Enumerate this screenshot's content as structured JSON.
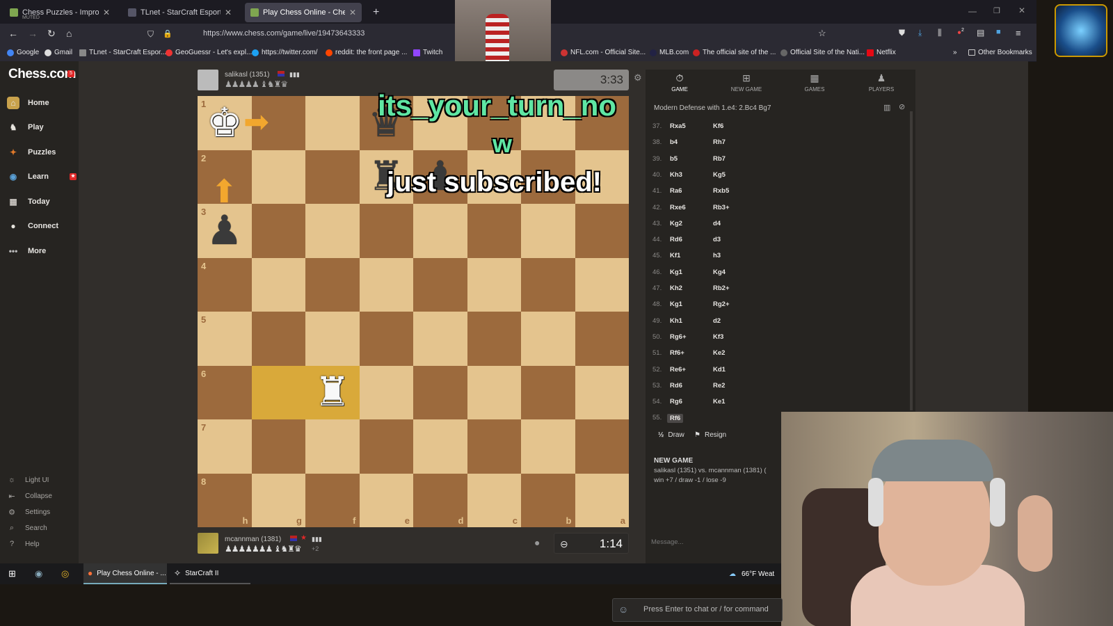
{
  "browser": {
    "tabs": [
      {
        "label": "Chess Puzzles - Improve Your C",
        "sub": "MUTED",
        "active": false
      },
      {
        "label": "TLnet - StarCraft Esports News",
        "active": false
      },
      {
        "label": "Play Chess Online - Chess.com",
        "active": true
      }
    ],
    "new_tab": "+",
    "url": "https://www.chess.com/game/live/19473643333",
    "bookmarks": [
      "Google",
      "Gmail",
      "TLnet - StarCraft Espor...",
      "GeoGuessr - Let's expl...",
      "https://twitter.com/",
      "reddit: the front page ...",
      "Twitch",
      "NFL.com - Official Site...",
      "MLB.com",
      "The official site of the ...",
      "Official Site of the Nati...",
      "Netflix"
    ],
    "other_bookmarks": "Other Bookmarks",
    "extension_badge": "2"
  },
  "sidebar": {
    "logo": "Chess.com",
    "logo_badge": "5",
    "items": [
      {
        "label": "Home",
        "icon": "home-icon"
      },
      {
        "label": "Play",
        "icon": "play-icon"
      },
      {
        "label": "Puzzles",
        "icon": "puzzle-icon"
      },
      {
        "label": "Learn",
        "icon": "learn-icon"
      },
      {
        "label": "Today",
        "icon": "calendar-icon"
      },
      {
        "label": "Connect",
        "icon": "connect-icon"
      },
      {
        "label": "More",
        "icon": "more-icon"
      }
    ],
    "bottom": [
      {
        "label": "Light UI",
        "icon": "sun-icon"
      },
      {
        "label": "Collapse",
        "icon": "collapse-icon"
      },
      {
        "label": "Settings",
        "icon": "gear-icon"
      },
      {
        "label": "Search",
        "icon": "search-icon"
      },
      {
        "label": "Help",
        "icon": "help-icon"
      }
    ]
  },
  "top_player": {
    "name": "salikasl (1351)",
    "captured": "♟♟♟♟♟ ♝♞♜♛",
    "clock": "3:33"
  },
  "bottom_player": {
    "name": "mcannman (1381)",
    "captured": "♟♟♟♟♟♟♟ ♝♞♜♛",
    "advantage": "+2",
    "clock": "1:14"
  },
  "board": {
    "ranks": [
      "1",
      "2",
      "3",
      "4",
      "5",
      "6",
      "7",
      "8"
    ],
    "files": [
      "h",
      "g",
      "f",
      "e",
      "d",
      "c",
      "b",
      "a"
    ],
    "highlight": [
      "g6",
      "f6"
    ]
  },
  "overlays": {
    "turn_line1": "its_your_turn_no",
    "turn_line2": "w",
    "subscribed": "just subscribed!"
  },
  "right_panel": {
    "tabs": [
      {
        "label": "GAME",
        "icon": "clock-icon"
      },
      {
        "label": "NEW GAME",
        "icon": "plus-icon"
      },
      {
        "label": "GAMES",
        "icon": "board-icon"
      },
      {
        "label": "PLAYERS",
        "icon": "players-icon"
      }
    ],
    "opening": "Modern Defense with 1.e4: 2.Bc4 Bg7",
    "moves": [
      {
        "n": "37.",
        "w": "Rxa5",
        "b": "Kf6"
      },
      {
        "n": "38.",
        "w": "b4",
        "b": "Rh7"
      },
      {
        "n": "39.",
        "w": "b5",
        "b": "Rb7"
      },
      {
        "n": "40.",
        "w": "Kh3",
        "b": "Kg5"
      },
      {
        "n": "41.",
        "w": "Ra6",
        "b": "Rxb5"
      },
      {
        "n": "42.",
        "w": "Rxe6",
        "b": "Rb3+"
      },
      {
        "n": "43.",
        "w": "Kg2",
        "b": "d4"
      },
      {
        "n": "44.",
        "w": "Rd6",
        "b": "d3"
      },
      {
        "n": "45.",
        "w": "Kf1",
        "b": "h3"
      },
      {
        "n": "46.",
        "w": "Kg1",
        "b": "Kg4"
      },
      {
        "n": "47.",
        "w": "Kh2",
        "b": "Rb2+"
      },
      {
        "n": "48.",
        "w": "Kg1",
        "b": "Rg2+"
      },
      {
        "n": "49.",
        "w": "Kh1",
        "b": "d2"
      },
      {
        "n": "50.",
        "w": "Rg6+",
        "b": "Kf3"
      },
      {
        "n": "51.",
        "w": "Rf6+",
        "b": "Ke2"
      },
      {
        "n": "52.",
        "w": "Re6+",
        "b": "Kd1"
      },
      {
        "n": "53.",
        "w": "Rd6",
        "b": "Re2"
      },
      {
        "n": "54.",
        "w": "Rg6",
        "b": "Ke1"
      },
      {
        "n": "55.",
        "w": "Rf6",
        "b": ""
      }
    ],
    "draw": "Draw",
    "resign": "Resign",
    "new_game_title": "NEW GAME",
    "new_game_line": "salikasl (1351) vs. mcannman (1381) (",
    "new_game_stakes": "win +7 / draw -1 / lose -9",
    "message_placeholder": "Message..."
  },
  "taskbar": {
    "items": [
      "Play Chess Online - ...",
      "StarCraft II"
    ],
    "weather": "66°F  Weat"
  },
  "chat": {
    "placeholder": "Press Enter to chat or / for command"
  },
  "colors": {
    "accent": "#f2a72e",
    "board_light": "#e4c48e",
    "board_dark": "#9c6a3d",
    "highlight": "#d9a93a"
  }
}
